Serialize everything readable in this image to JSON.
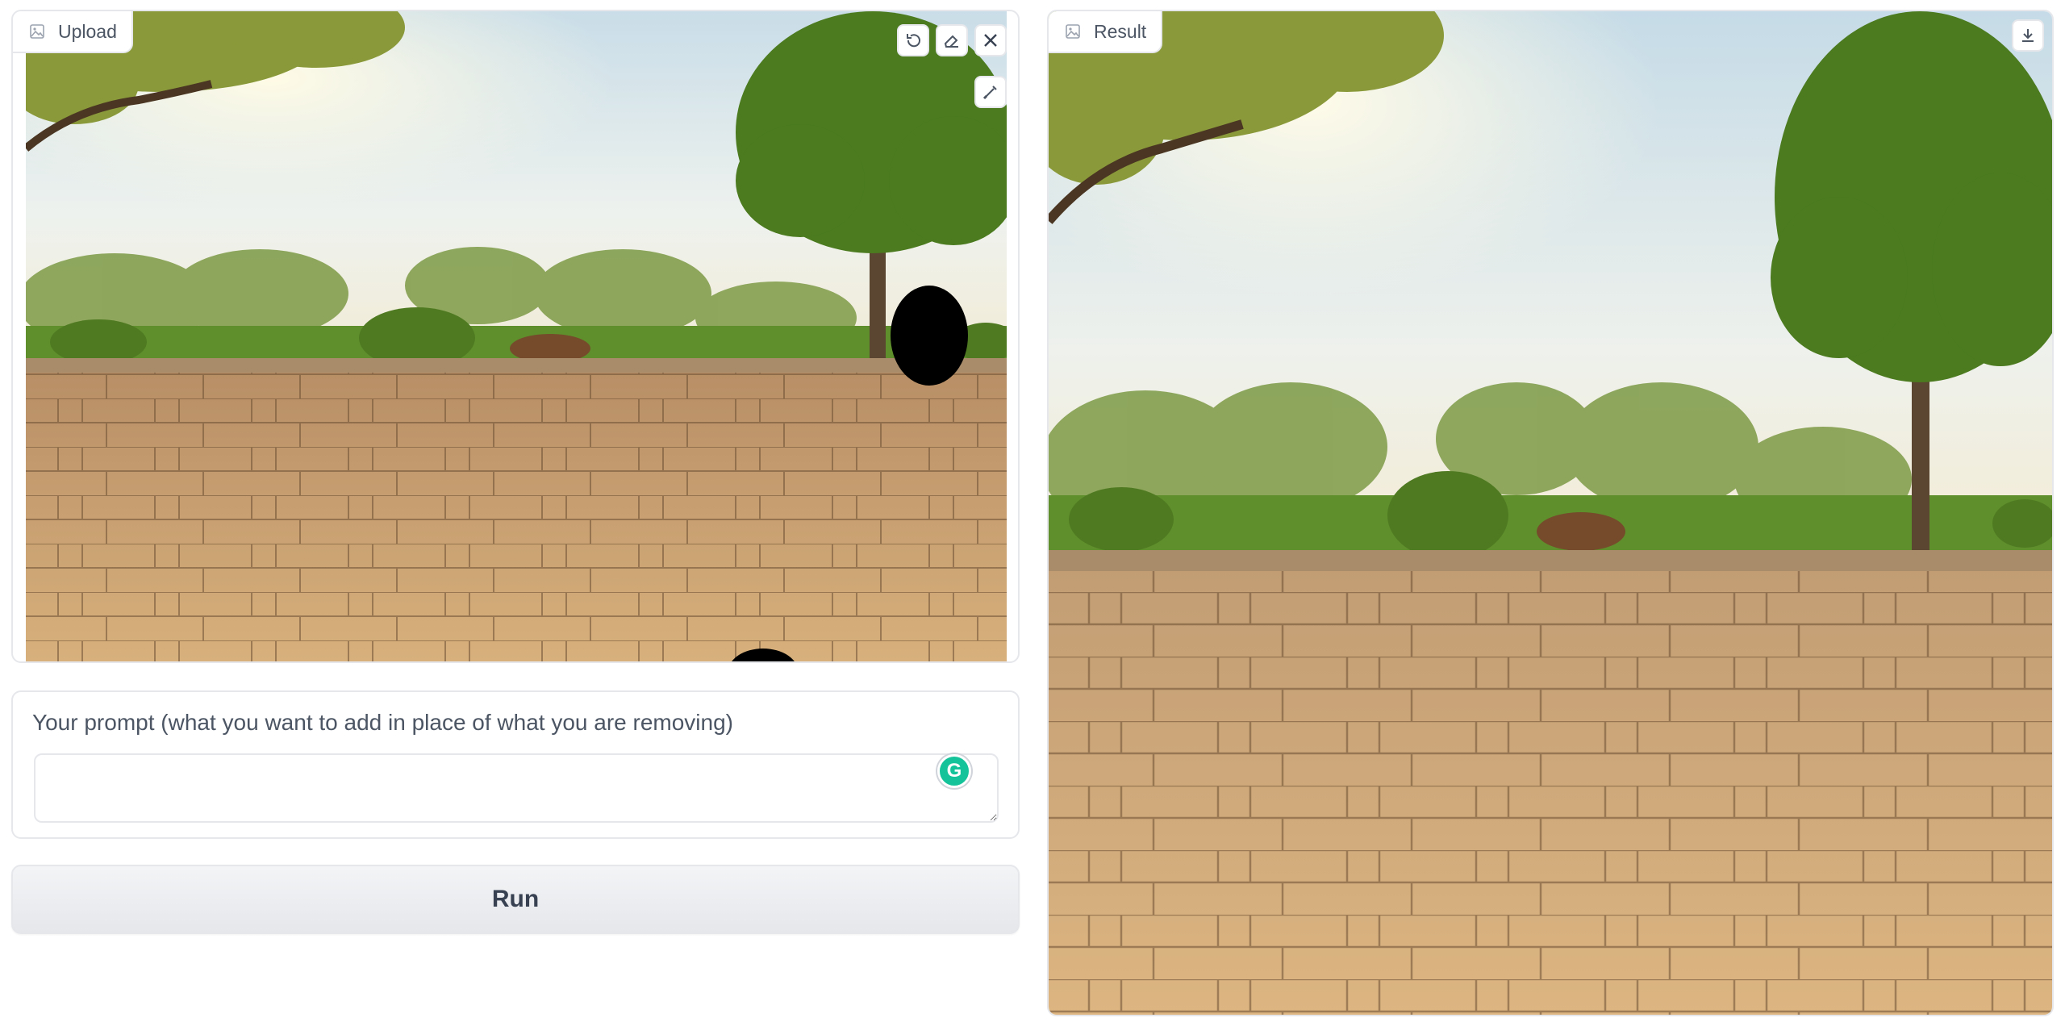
{
  "upload": {
    "tag_label": "Upload",
    "tag_icon": "image-icon",
    "tools": [
      "undo-icon",
      "eraser-icon",
      "close-icon",
      "brush-icon"
    ]
  },
  "prompt": {
    "label": "Your prompt (what you want to add in place of what you are removing)",
    "value": "",
    "placeholder": ""
  },
  "run_label": "Run",
  "result": {
    "tag_label": "Result",
    "tag_icon": "image-icon",
    "download_icon": "download-icon"
  },
  "colors": {
    "border": "#e5e7eb",
    "sky": "#dfe9ee",
    "foliage": "#5c8a2a",
    "pavement": "#c9a06e",
    "mask": "#000000",
    "grammarly": "#15c39a"
  }
}
